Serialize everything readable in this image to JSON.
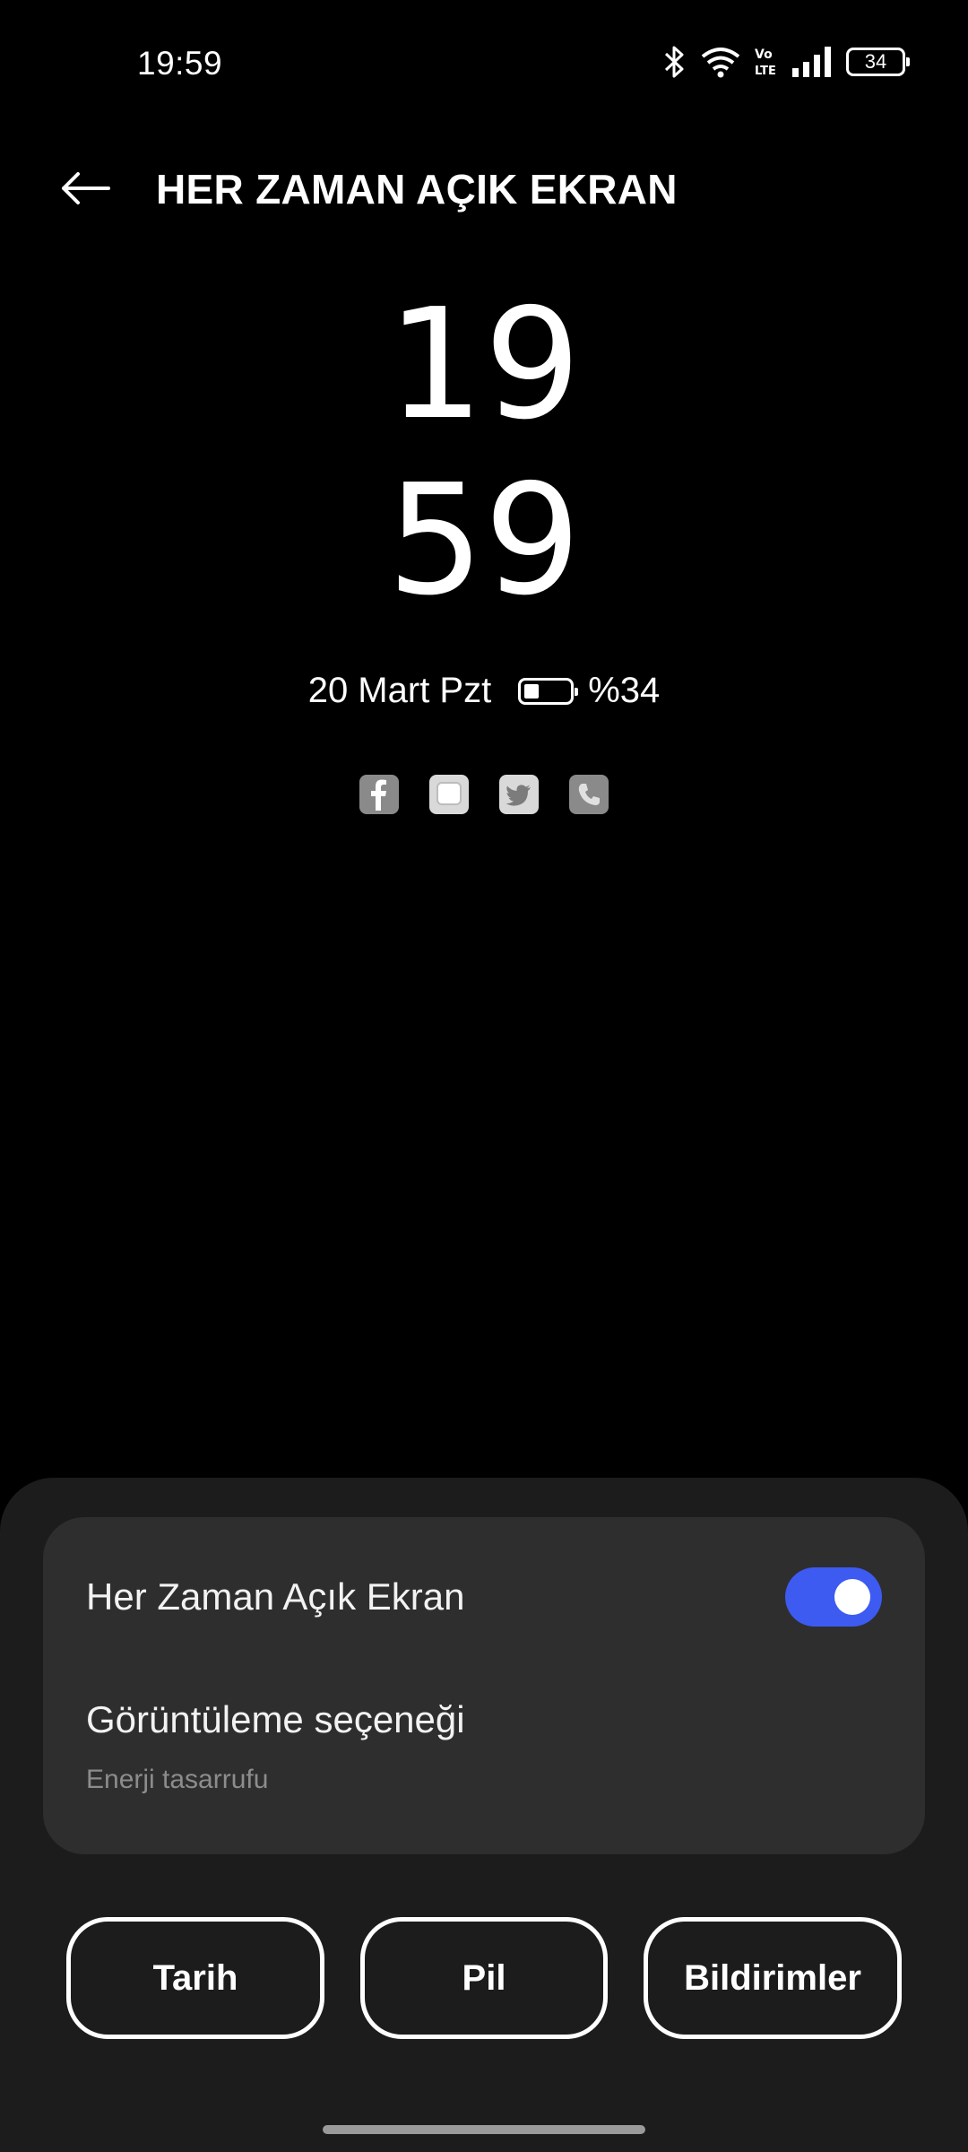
{
  "status_bar": {
    "time": "19:59",
    "battery_level": "34",
    "icons": [
      "bluetooth-icon",
      "wifi-icon",
      "volte-icon",
      "signal-icon",
      "battery-icon"
    ],
    "volte_label": "Vo LTE"
  },
  "header": {
    "title": "HER ZAMAN AÇIK EKRAN",
    "back_icon": "arrow-left-icon"
  },
  "preview": {
    "hour": "19",
    "minute": "59",
    "date": "20 Mart Pzt",
    "battery_text": "%34",
    "battery_fraction": 0.34,
    "notification_icons": [
      "facebook-icon",
      "messages-icon",
      "twitter-icon",
      "phone-icon"
    ]
  },
  "settings": {
    "aod_label": "Her Zaman Açık Ekran",
    "aod_enabled": true,
    "display_option_label": "Görüntüleme seçeneği",
    "display_option_value": "Enerji tasarrufu"
  },
  "chips": {
    "date": "Tarih",
    "battery": "Pil",
    "notifications": "Bildirimler"
  },
  "colors": {
    "background": "#000000",
    "sheet": "#1c1c1c",
    "card": "#2e2e2e",
    "accent": "#3d5af1"
  }
}
